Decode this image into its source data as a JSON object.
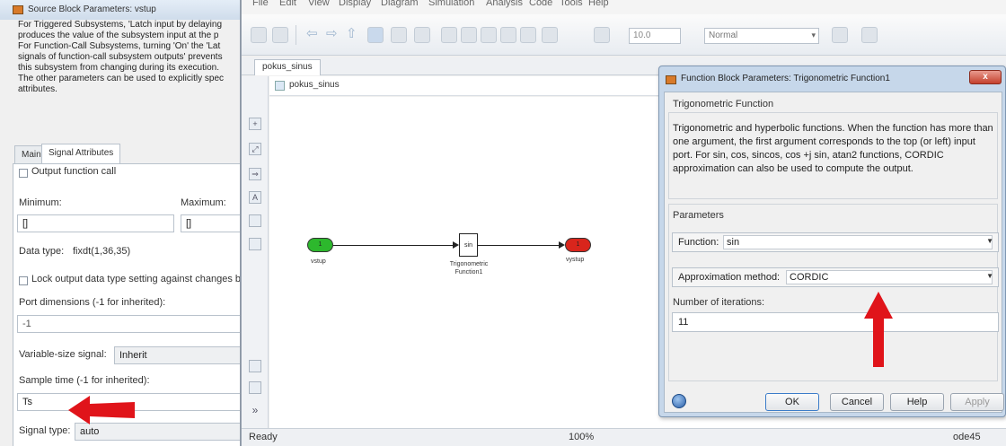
{
  "colors": {
    "annotation_arrow": "#e0141a",
    "inport_block": "#2db82d",
    "outport_block": "#d9251c"
  },
  "model_window": {
    "menu": [
      "File",
      "Edit",
      "View",
      "Display",
      "Diagram",
      "Simulation",
      "Analysis",
      "Code",
      "Tools",
      "Help"
    ],
    "stop_time": "10.0",
    "simulation_mode": "Normal",
    "model_tab": "pokus_sinus",
    "breadcrumb": "pokus_sinus",
    "blocks": {
      "inport": {
        "number": "1",
        "label": "vstup"
      },
      "trig": {
        "text": "sin",
        "label_line1": "Trigonometric",
        "label_line2": "Function1"
      },
      "outport": {
        "number": "1",
        "label": "vystup"
      }
    },
    "status": {
      "ready": "Ready",
      "zoom": "100%",
      "solver": "ode45"
    }
  },
  "source_dialog": {
    "title": "Source Block Parameters: vstup",
    "description_lines": [
      "For Triggered Subsystems, 'Latch input by delaying",
      "produces the value of the subsystem input at the p",
      "For Function-Call Subsystems, turning 'On' the 'Lat",
      "signals of function-call subsystem outputs' prevents",
      "this subsystem from changing during its execution.",
      "The other parameters can be used to explicitly spec",
      "attributes."
    ],
    "tabs": {
      "main": "Main",
      "signal_attributes": "Signal Attributes"
    },
    "output_function_call": "Output function call",
    "minimum_label": "Minimum:",
    "minimum_value": "[]",
    "maximum_label": "Maximum:",
    "maximum_value": "[]",
    "data_type_label": "Data type:",
    "data_type_value": "fixdt(1,36,35)",
    "lock_output": "Lock output data type setting against changes by",
    "port_dims_label": "Port dimensions (-1 for inherited):",
    "port_dims_value": "-1",
    "var_size_label": "Variable-size signal:",
    "var_size_value": "Inherit",
    "sample_time_label": "Sample time (-1 for inherited):",
    "sample_time_value": "Ts",
    "signal_type_label": "Signal type:",
    "signal_type_value": "auto"
  },
  "function_dialog": {
    "title": "Function Block Parameters: Trigonometric Function1",
    "close": "x",
    "group_title": "Trigonometric Function",
    "description_lines": [
      "Trigonometric and hyperbolic functions. When the function has more than",
      "one argument, the first argument corresponds to the top (or left) input",
      "port. For sin, cos, sincos, cos +j sin, atan2 functions, CORDIC",
      "approximation can also be used to compute the output."
    ],
    "parameters_title": "Parameters",
    "function_label": "Function:",
    "function_value": "sin",
    "approx_label": "Approximation method:",
    "approx_value": "CORDIC",
    "iterations_label": "Number of iterations:",
    "iterations_value": "11",
    "buttons": {
      "ok": "OK",
      "cancel": "Cancel",
      "help": "Help",
      "apply": "Apply"
    }
  }
}
